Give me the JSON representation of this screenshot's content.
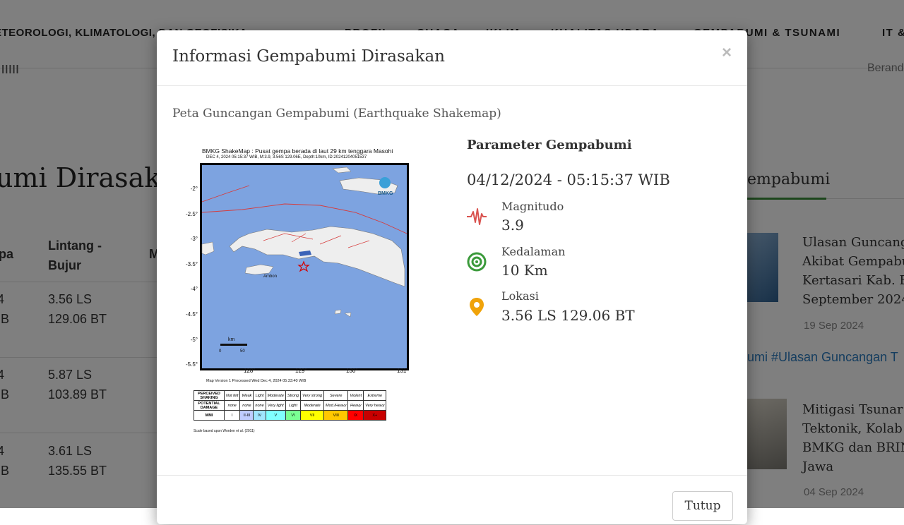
{
  "background": {
    "brand_text": "ETEOROLOGI, KLIMATOLOGI, DAN GEOFISIKA",
    "brand_sub": "ıııııı",
    "nav": [
      "PROFIL",
      "CUACA",
      "IKLIM",
      "KUALITAS UDARA",
      "GEMPABUMI & TSUNAMI",
      "IT &"
    ],
    "beranda": "Berand",
    "page_title": "umi Dirasak",
    "table_headers": [
      "pa",
      "Lintang -\nBujur",
      "M"
    ],
    "rows": [
      {
        "a": "4",
        "b": "IB",
        "lat": "3.56 LS",
        "lon": "129.06 BT"
      },
      {
        "a": "4",
        "b": "IB",
        "lat": "5.87 LS",
        "lon": "103.89 BT"
      },
      {
        "a": "4",
        "b": "IB",
        "lat": "3.61 LS",
        "lon": "135.55 BT"
      }
    ],
    "sidebar_title": "empabumi",
    "articles": [
      {
        "line1": "Ulasan Guncang",
        "line2": "Akibat Gempabu",
        "line3": "Kertasari Kab. E",
        "line4": "September 2024",
        "date": "19 Sep 2024"
      },
      {
        "line1": "Mitigasi Tsunar",
        "line2": "Tektonik, Kolab",
        "line3": "BMKG dan BRIN",
        "line4": "Jawa",
        "date": "04 Sep 2024"
      }
    ],
    "tags": "umi #Ulasan Guncangan T"
  },
  "modal": {
    "title": "Informasi Gempabumi Dirasakan",
    "close_symbol": "×",
    "section_title": "Peta Guncangan Gempabumi (Earthquake Shakemap)",
    "close_button": "Tutup",
    "shakemap": {
      "title": "BMKG ShakeMap : Pusat gempa berada di laut 29 km tenggara Masohi",
      "subtitle": "DEC 4, 2024 05:15:37 WIB, M:3.9, 3.56S 129.06E, Depth:10km, ID:20241204051537",
      "logo_text": "BMKG",
      "ambon_label": "Ambon",
      "yticks": [
        "-2°",
        "-2.5°",
        "-3°",
        "-3.5°",
        "-4°",
        "-4.5°",
        "-5°",
        "-5.5°"
      ],
      "xticks": [
        "128°",
        "129°",
        "130°",
        "131°"
      ],
      "scale_label": "km",
      "scale_ticks": [
        "0",
        "50"
      ],
      "version": "Map Version 1 Processed Wed Dec 4, 2024 05:33:40 WIB",
      "legend": {
        "rows": [
          {
            "head": "PERCEIVED SHAKING",
            "cells": [
              "Not felt",
              "Weak",
              "Light",
              "Moderate",
              "Strong",
              "Very strong",
              "Severe",
              "Violent",
              "Extreme"
            ]
          },
          {
            "head": "POTENTIAL DAMAGE",
            "cells": [
              "none",
              "none",
              "none",
              "Very light",
              "Light",
              "Moderate",
              "Mod./Heavy",
              "Heavy",
              "Very heavy"
            ]
          },
          {
            "head": "MMI",
            "cells": [
              "I",
              "II-III",
              "IV",
              "V",
              "VI",
              "VII",
              "VIII",
              "IX",
              "X+"
            ]
          }
        ],
        "mmi_colors": [
          "#ffffff",
          "#bfccff",
          "#a0e6ff",
          "#80ffff",
          "#7aff93",
          "#ffff00",
          "#ffc800",
          "#ff0000",
          "#c80000"
        ]
      },
      "scale_note": "Scale based upon Worden et al. (2011)"
    },
    "parameters": {
      "title": "Parameter Gempabumi",
      "datetime": "04/12/2024 - 05:15:37 WIB",
      "items": [
        {
          "label": "Magnitudo",
          "value": "3.9",
          "icon": "seismograph-icon",
          "color": "#d9534f"
        },
        {
          "label": "Kedalaman",
          "value": "10 Km",
          "icon": "depth-rings-icon",
          "color": "#3b9a3b"
        },
        {
          "label": "Lokasi",
          "value": "3.56 LS 129.06 BT",
          "icon": "location-pin-icon",
          "color": "#f0a30a"
        }
      ]
    }
  }
}
